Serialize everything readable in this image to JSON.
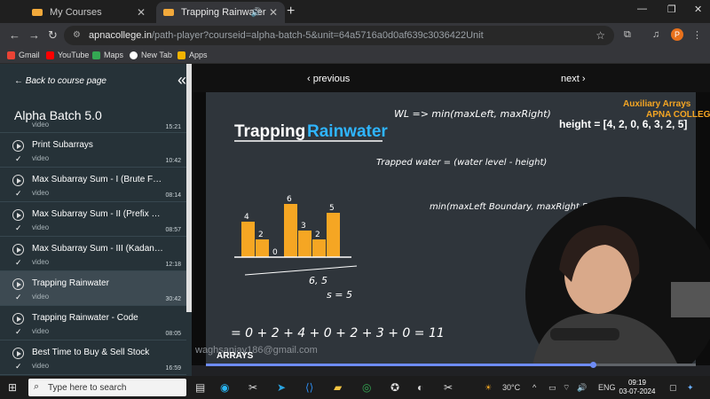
{
  "browser": {
    "tabs": [
      {
        "title": "My Courses",
        "active": false
      },
      {
        "title": "Trapping Rainwater",
        "active": true
      }
    ],
    "url_host": "apnacollege.in",
    "url_rest": "/path-player?courseid=alpha-batch-5&unit=64a5716a0d0af639c3036422Unit",
    "profile_initial": "P",
    "bookmarks": [
      "Gmail",
      "YouTube",
      "Maps",
      "New Tab",
      "Apps"
    ]
  },
  "sidebar": {
    "back_label": "Back to course page",
    "course_title": "Alpha Batch 5.0",
    "lessons": [
      {
        "name": "video",
        "type": "",
        "duration": "15:21",
        "partial": true
      },
      {
        "name": "Print Subarrays",
        "type": "video",
        "duration": "10:42"
      },
      {
        "name": "Max Subarray Sum - I (Brute Force)",
        "type": "video",
        "duration": "08:14"
      },
      {
        "name": "Max Subarray Sum - II (Prefix Sum)",
        "type": "video",
        "duration": "08:57"
      },
      {
        "name": "Max Subarray Sum - III (Kadane's)",
        "type": "video",
        "duration": "12:18"
      },
      {
        "name": "Trapping Rainwater",
        "type": "video",
        "duration": "30:42",
        "active": true
      },
      {
        "name": "Trapping Rainwater - Code",
        "type": "video",
        "duration": "08:05"
      },
      {
        "name": "Best Time to Buy & Sell Stock",
        "type": "video",
        "duration": "16:59"
      }
    ]
  },
  "player": {
    "prev_label": "previous",
    "next_label": "next",
    "slide": {
      "title_a": "Trapping",
      "title_b": "Rainwater",
      "height_text": "height = [4, 2, 0, 6, 3, 2, 5]",
      "brand_a": "Auxiliary Arrays",
      "brand_b": "APNA COLLEGE",
      "footer": "ARRAYS",
      "watermark": "waghsanjay186@gmail.com",
      "wl_note": "WL => min(maxLeft, maxRight)",
      "trapped_note": "Trapped water = (water level - height)",
      "bound_note": "min(maxLeft Boundary, maxRight Boundary)",
      "sum_note": "= 0 + 2 + 4 + 0 + 2 + 3 + 0 = 11",
      "bar_heights": [
        4,
        2,
        0,
        6,
        3,
        2,
        5
      ],
      "bar_labels": [
        "4",
        "2",
        "0",
        "6",
        "3",
        "2",
        "5"
      ],
      "idx_note": "6, 5",
      "size_note": "s = 5"
    },
    "progress": 0.79
  },
  "taskbar": {
    "search_placeholder": "Type here to search",
    "temperature": "30°C",
    "lang": "ENG",
    "time": "09:19",
    "date": "03-07-2024"
  }
}
